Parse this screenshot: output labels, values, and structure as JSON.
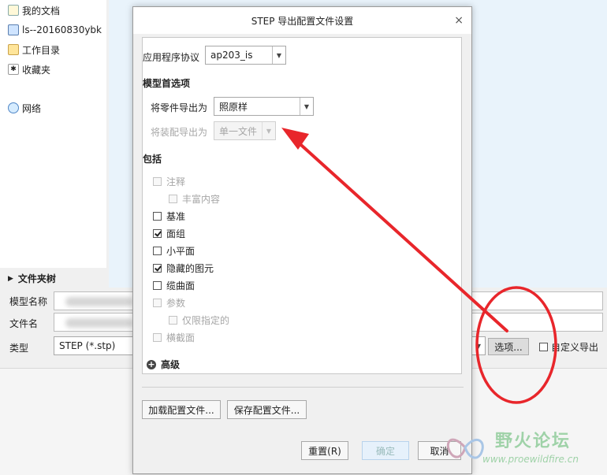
{
  "background": {
    "nav_items": [
      {
        "label": "我的文档",
        "icon": "document-icon"
      },
      {
        "label": "ls--20160830ybk",
        "icon": "computer-icon"
      },
      {
        "label": "工作目录",
        "icon": "folder-icon"
      },
      {
        "label": "收藏夹",
        "icon": "favorites-icon"
      },
      {
        "label": "网络",
        "icon": "network-icon"
      }
    ],
    "folder_tree_label": "文件夹树",
    "model_name_label": "模型名称",
    "file_name_label": "文件名",
    "type_label": "类型",
    "type_value": "STEP (*.stp)",
    "options_button": "选项...",
    "custom_export_label": "自定义导出",
    "custom_export_checked": false
  },
  "dialog": {
    "title": "STEP 导出配置文件设置",
    "close_glyph": "×",
    "protocol_label": "应用程序协议",
    "protocol_value": "ap203_is",
    "model_prefs_title": "模型首选项",
    "part_export_label": "将零件导出为",
    "part_export_value": "照原样",
    "assembly_export_label": "将装配导出为",
    "assembly_export_value": "单一文件",
    "include_title": "包括",
    "include_options": [
      {
        "label": "注释",
        "checked": false,
        "enabled": false
      },
      {
        "label": "丰富内容",
        "checked": false,
        "enabled": false
      },
      {
        "label": "基准",
        "checked": false,
        "enabled": true
      },
      {
        "label": "面组",
        "checked": true,
        "enabled": true
      },
      {
        "label": "小平面",
        "checked": false,
        "enabled": true
      },
      {
        "label": "隐藏的图元",
        "checked": true,
        "enabled": true
      },
      {
        "label": "缆曲面",
        "checked": false,
        "enabled": true
      },
      {
        "label": "参数",
        "checked": false,
        "enabled": false
      },
      {
        "label": "仅限指定的",
        "checked": false,
        "enabled": false
      },
      {
        "label": "横截面",
        "checked": false,
        "enabled": false
      }
    ],
    "advanced_label": "高级",
    "load_config_button": "加载配置文件...",
    "save_config_button": "保存配置文件...",
    "reset_button": "重置(R)",
    "ok_button": "确定",
    "cancel_button": "取消"
  },
  "watermark": {
    "text": "野火论坛",
    "url": "www.proewildfire.cn"
  },
  "annotation_color": "#e8262b"
}
